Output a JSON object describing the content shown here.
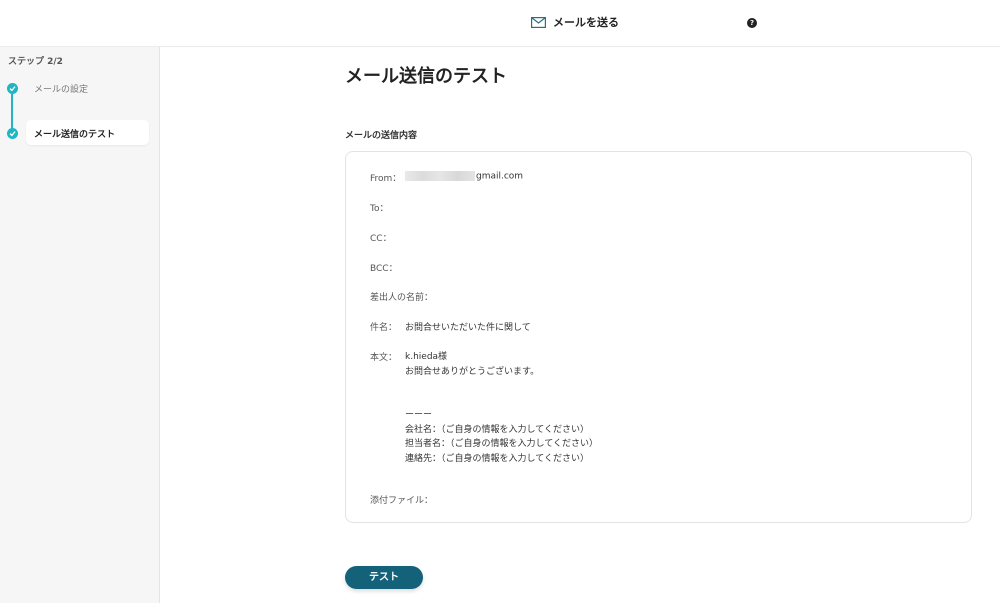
{
  "header": {
    "title": "メールを送る",
    "help": "?"
  },
  "sidebar": {
    "step_label": "ステップ 2/2",
    "steps": [
      {
        "label": "メールの設定"
      },
      {
        "label": "メール送信のテスト"
      }
    ]
  },
  "main": {
    "page_title": "メール送信のテスト",
    "section_label": "メールの送信内容",
    "fields": {
      "from_label": "From：",
      "from_value": "gmail.com",
      "to_label": "To：",
      "cc_label": "CC：",
      "bcc_label": "BCC：",
      "sender_label": "差出人の名前：",
      "subject_label": "件名：",
      "subject_value": "お問合せいただいた件に関して",
      "body_label": "本文：",
      "body_lines": [
        "k.hieda様",
        "お問合せありがとうございます。",
        "",
        "",
        "ーーー",
        "会社名：（ご自身の情報を入力してください）",
        "担当者名：（ご自身の情報を入力してください）",
        "連絡先：（ご自身の情報を入力してください）"
      ],
      "attach_label": "添付ファイル："
    },
    "test_button": "テスト"
  }
}
